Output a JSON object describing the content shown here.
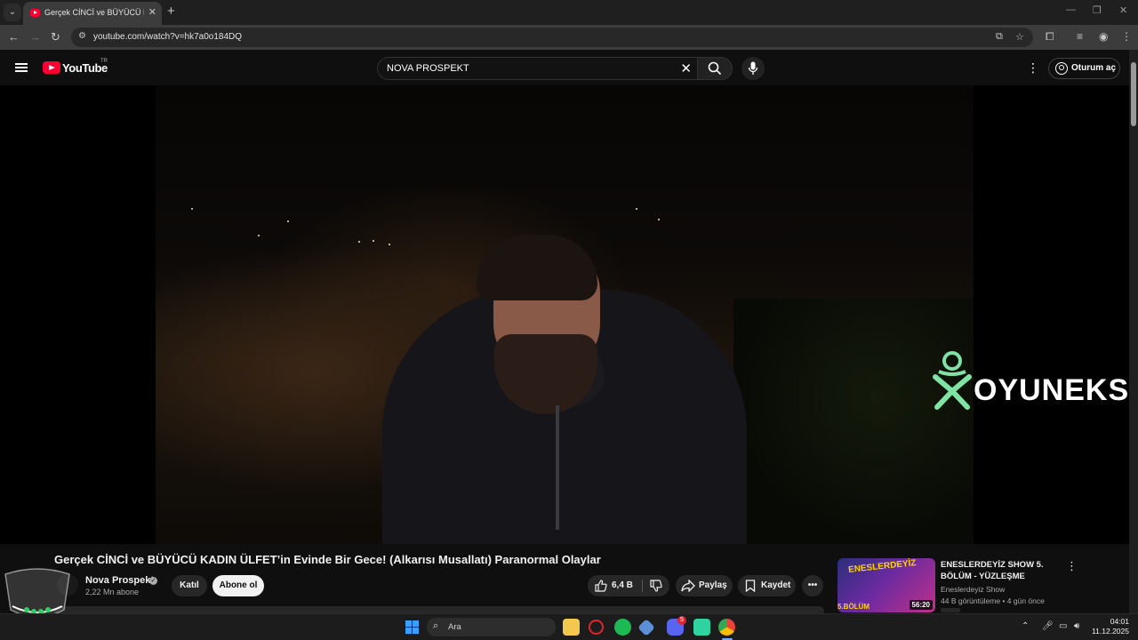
{
  "browser": {
    "tab_title": "Gerçek CİNCİ ve BÜYÜCÜ KADIN",
    "url": "youtube.com/watch?v=hk7a0o184DQ"
  },
  "youtube": {
    "logo_text": "YouTube",
    "region": "TR",
    "search_value": "NOVA PROSPEKT",
    "signin_label": "Oturum aç"
  },
  "video": {
    "watermark": "OYUNEKS",
    "brand_color": "#7fe3a6",
    "title": "Gerçek CİNCİ ve BÜYÜCÜ KADIN ÜLFET’in Evinde Bir Gece! (Alkarısı Musallatı) Paranormal Olaylar"
  },
  "channel": {
    "name": "Nova Prospekt",
    "subscribers": "2,22 Mn abone",
    "join_label": "Katıl",
    "subscribe_label": "Abone ol"
  },
  "actions": {
    "likes": "6,4 B",
    "share_label": "Paylaş",
    "save_label": "Kaydet"
  },
  "recommended": {
    "thumb_text": "ENESLERDEYİZ",
    "thumb_episode": "5.BÖLÜM",
    "duration": "56:20",
    "title": "ENESLERDEYİZ SHOW 5. BÖLÜM - YÜZLEŞME",
    "channel": "Eneslerdeyiz Show",
    "meta": "44 B görüntüleme • 4 gün önce"
  },
  "taskbar": {
    "search_label": "Ara",
    "discord_badge": "5",
    "time": "04:01",
    "date": "11.12.2025"
  }
}
